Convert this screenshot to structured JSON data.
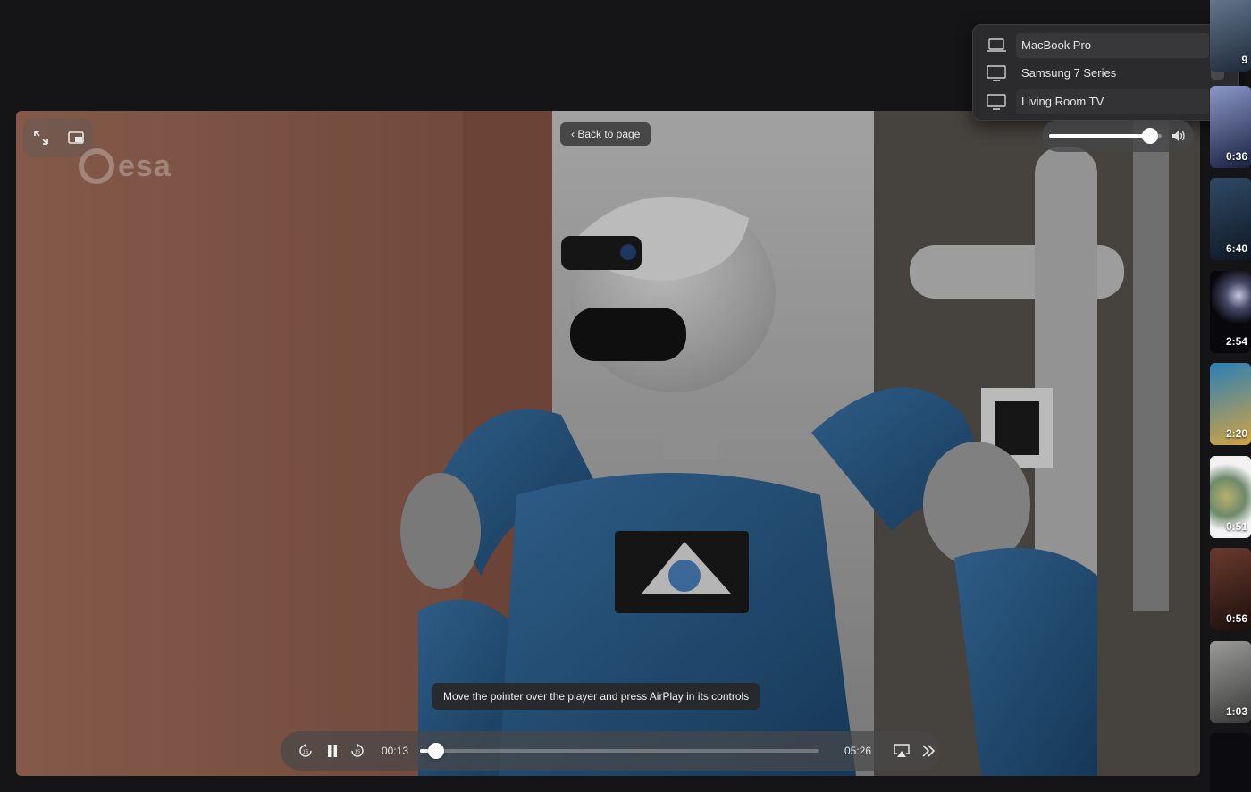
{
  "player": {
    "back_label": "‹ Back to page",
    "tooltip": "Move the pointer over the player and press AirPlay in its controls",
    "elapsed": "00:13",
    "duration": "05:26",
    "progress_fraction": 0.04,
    "logo_text": "esa"
  },
  "airplay": {
    "devices": [
      {
        "label": "MacBook Pro",
        "icon": "laptop-icon",
        "selected": true
      },
      {
        "label": "Samsung 7 Series",
        "icon": "tv-icon",
        "selected": false
      },
      {
        "label": "Living Room TV",
        "icon": "tv-icon",
        "selected": false
      }
    ],
    "volume_fraction": 0.9
  },
  "sidebar": {
    "durations": [
      "9",
      "0:36",
      "6:40",
      "2:54",
      "2:20",
      "0:51",
      "0:56",
      "1:03"
    ]
  },
  "colors": {
    "accent": "#2f6de0",
    "background": "#151517"
  }
}
